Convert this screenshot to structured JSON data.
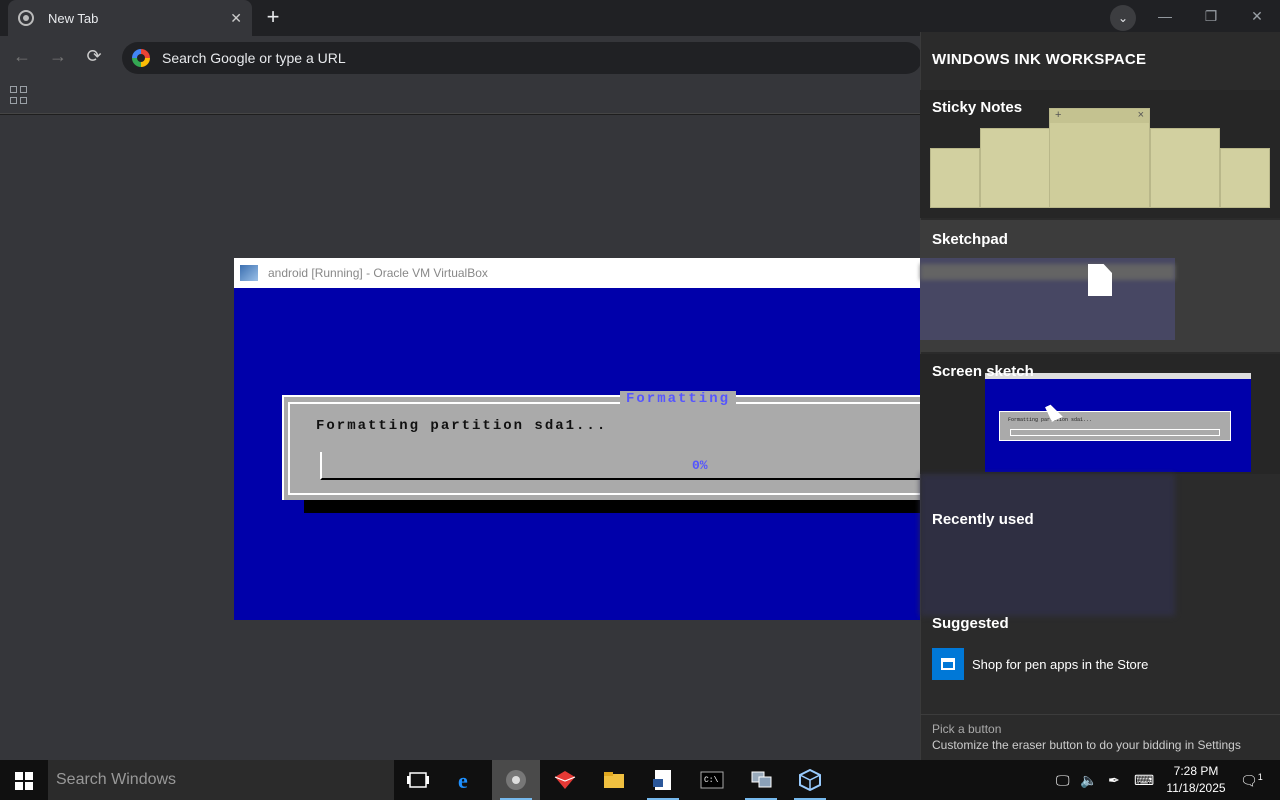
{
  "browser": {
    "tab_title": "New Tab",
    "tab_close": "✕",
    "new_tab": "+",
    "tab_menu": "⌄",
    "omnibox_placeholder": "Search Google or type a URL",
    "back": "←",
    "forward": "→",
    "reload": "⟳",
    "minimize": "—",
    "maximize": "❐",
    "close": "✕"
  },
  "vbox": {
    "title": "android [Running] - Oracle VM VirtualBox",
    "dialog_title": "Formatting",
    "message": "Formatting partition sda1...",
    "progress_text": "0%",
    "progress_fraction": 0
  },
  "ink": {
    "title": "WINDOWS INK WORKSPACE",
    "sticky_title": "Sticky Notes",
    "note_plus": "+",
    "note_close": "×",
    "sketchpad_title": "Sketchpad",
    "screen_sketch_title": "Screen sketch",
    "thumb_text": "Formatting partition sda1...",
    "recent_title": "Recently used",
    "suggested_title": "Suggested",
    "store_text": "Shop for pen apps in the Store",
    "footer_title": "Pick a button",
    "footer_text": "Customize the eraser button to do your bidding in Settings"
  },
  "taskbar": {
    "search_placeholder": "Search Windows",
    "time": "7:28 PM",
    "date": "11/18/2025",
    "notification_count": "1",
    "apps": [
      "task-view",
      "edge",
      "chrome",
      "app-red",
      "file-explorer",
      "document",
      "terminal",
      "computer",
      "virtualbox"
    ]
  },
  "colors": {
    "vm_blue": "#0000aa",
    "dialog_gray": "#aaaaaa",
    "dialog_accent": "#5555ff",
    "note_yellow": "#d2d0a0",
    "store_blue": "#0078d7",
    "taskbar_accent": "#76b9ed"
  }
}
